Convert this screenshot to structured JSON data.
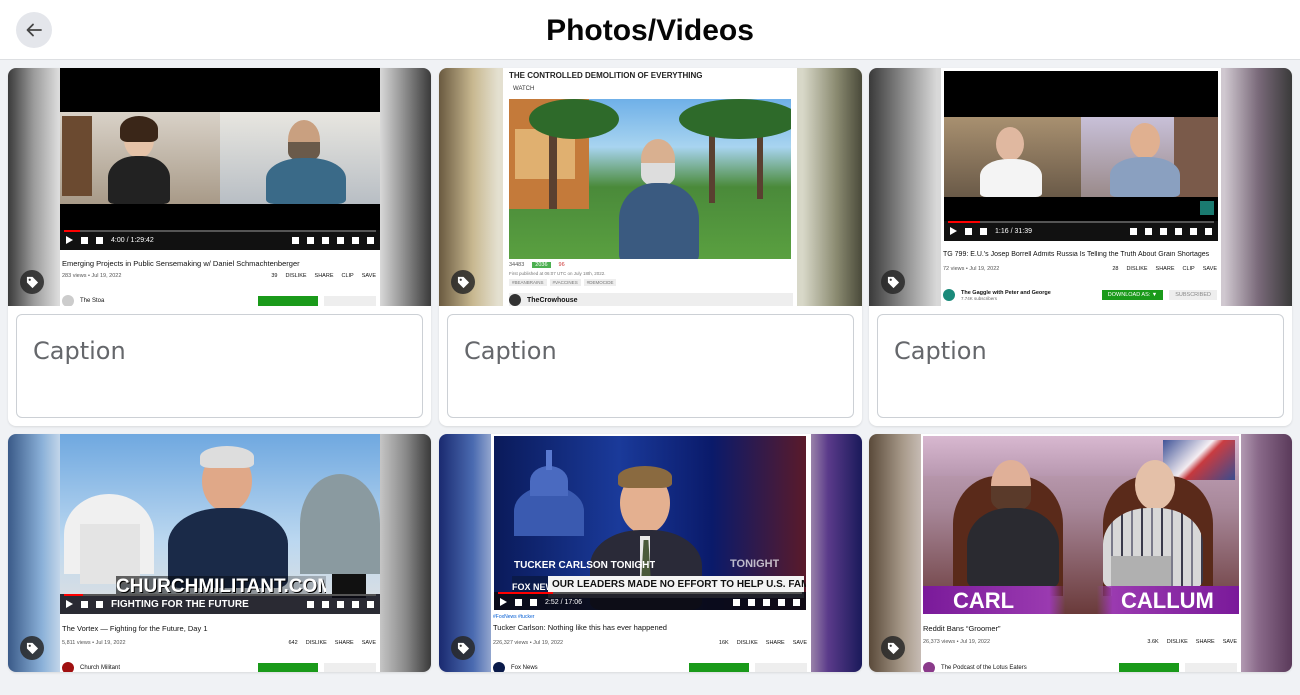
{
  "header": {
    "title": "Photos/Videos"
  },
  "caption_placeholder": "Caption",
  "cards": [
    {
      "video_title": "Emerging Projects in Public Sensemaking w/ Daniel Schmachtenberger",
      "views": "283 views • Jul 19, 2022",
      "time": "4:00 / 1:29:42",
      "likes": "39",
      "dislike": "DISLIKE",
      "share": "SHARE",
      "clip": "CLIP",
      "save": "SAVE",
      "channel": "The Stoa"
    },
    {
      "headline": "THE CONTROLLED DEMOLITION OF EVERYTHING",
      "watch": "WATCH",
      "views_count": "34483",
      "up": "2036",
      "down": "96",
      "published": "First published at 06:07 UTC on July 18th, 2022.",
      "tags": [
        "#BEANBRAINS",
        "#VACCINES",
        "#DEMOCIDE"
      ],
      "channel": "TheCrowhouse"
    },
    {
      "video_title": "TG 799: E.U.'s Josep Borrell Admits Russia Is Telling the Truth About Grain Shortages",
      "views": "72 views • Jul 19, 2022",
      "time": "1:16 / 31:39",
      "likes": "28",
      "dislike": "DISLIKE",
      "share": "SHARE",
      "clip": "CLIP",
      "save": "SAVE",
      "channel": "The Gaggle with Peter and George",
      "subs": "7.74K subscribers",
      "download": "DOWNLOAD AS: ▼",
      "subscribed": "SUBSCRIBED"
    },
    {
      "banner": "CHURCHMILITANT.COM/FFF",
      "banner2": "FIGHTING FOR THE FUTURE",
      "video_title": "The Vortex — Fighting for the Future, Day 1",
      "views": "5,811 views • Jul 19, 2022",
      "likes": "642",
      "dislike": "DISLIKE",
      "share": "SHARE",
      "save": "SAVE",
      "channel": "Church Militant"
    },
    {
      "banner": "OUR LEADERS MADE NO EFFORT TO HELP U.S. FAMILIES",
      "banner2": "TUCKER CARLSON TONIGHT",
      "network": "FOX NEWS",
      "tonight": "TONIGHT",
      "hashtags": "#FoxNews #tucker",
      "video_title": "Tucker Carlson: Nothing like this has ever happened",
      "views": "226,327 views • Jul 19, 2022",
      "time": "2:52 / 17:06",
      "likes": "16K",
      "dislike": "DISLIKE",
      "share": "SHARE",
      "save": "SAVE",
      "channel": "Fox News"
    },
    {
      "name_left": "CARL",
      "name_right": "CALLUM",
      "video_title": "Reddit Bans “Groomer”",
      "views": "26,373 views • Jul 19, 2022",
      "likes": "3.6K",
      "dislike": "DISLIKE",
      "share": "SHARE",
      "save": "SAVE",
      "channel": "The Podcast of the Lotus Eaters"
    }
  ]
}
